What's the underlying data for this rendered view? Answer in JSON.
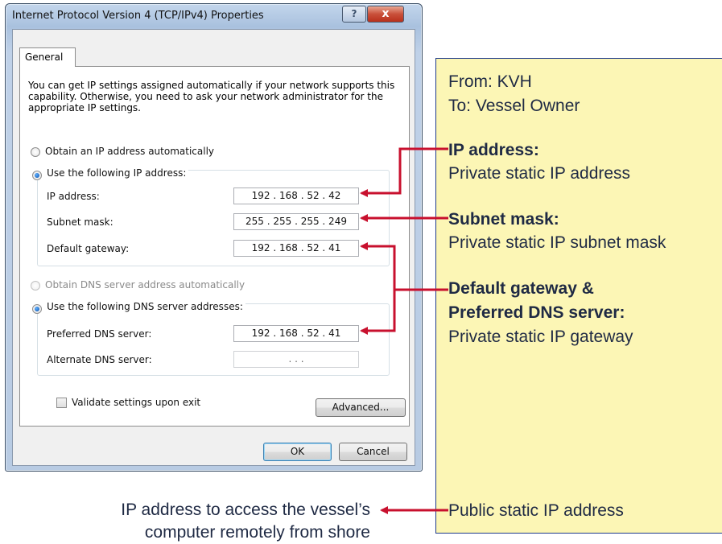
{
  "window": {
    "title": "Internet Protocol Version 4 (TCP/IPv4) Properties",
    "help_label": "?",
    "close_label": "x"
  },
  "tabs": [
    {
      "label": "General",
      "active": true
    }
  ],
  "intro_text": "You can get IP settings assigned automatically if your network supports this capability. Otherwise, you need to ask your network administrator for the appropriate IP settings.",
  "ip_section": {
    "auto_label": "Obtain an IP address automatically",
    "manual_label": "Use the following IP address:",
    "selected": "manual",
    "fields": [
      {
        "label": "IP address:",
        "value": "192 . 168 . 52 . 42"
      },
      {
        "label": "Subnet mask:",
        "value": "255 . 255 . 255 . 249"
      },
      {
        "label": "Default gateway:",
        "value": "192 . 168 . 52 . 41"
      }
    ]
  },
  "dns_section": {
    "auto_label": "Obtain DNS server address automatically",
    "manual_label": "Use the following DNS server addresses:",
    "selected": "manual",
    "fields": [
      {
        "label": "Preferred DNS server:",
        "value": "192 . 168 . 52 . 41"
      },
      {
        "label": "Alternate DNS server:",
        "value": ".     .     ."
      }
    ]
  },
  "validate_label": "Validate settings upon exit",
  "validate_checked": false,
  "advanced_label": "Advanced...",
  "ok_label": "OK",
  "cancel_label": "Cancel",
  "annotation": {
    "from": "From: KVH",
    "to": "To: Vessel Owner",
    "items": [
      {
        "title": "IP address:",
        "desc": "Private static IP address"
      },
      {
        "title": "Subnet mask:",
        "desc": "Private static IP subnet mask"
      },
      {
        "title_line1": "Default gateway &",
        "title_line2": "Preferred DNS server:",
        "desc": "Private static IP gateway"
      }
    ],
    "public_ip": "Public static IP address"
  },
  "bottom_caption": {
    "line1": "IP address to access the vessel’s",
    "line2": "computer remotely from shore"
  },
  "colors": {
    "arrow": "#c8102e",
    "note_bg": "#fcf6b5",
    "note_border": "#1e3a8a",
    "note_text": "#1f2a44"
  }
}
